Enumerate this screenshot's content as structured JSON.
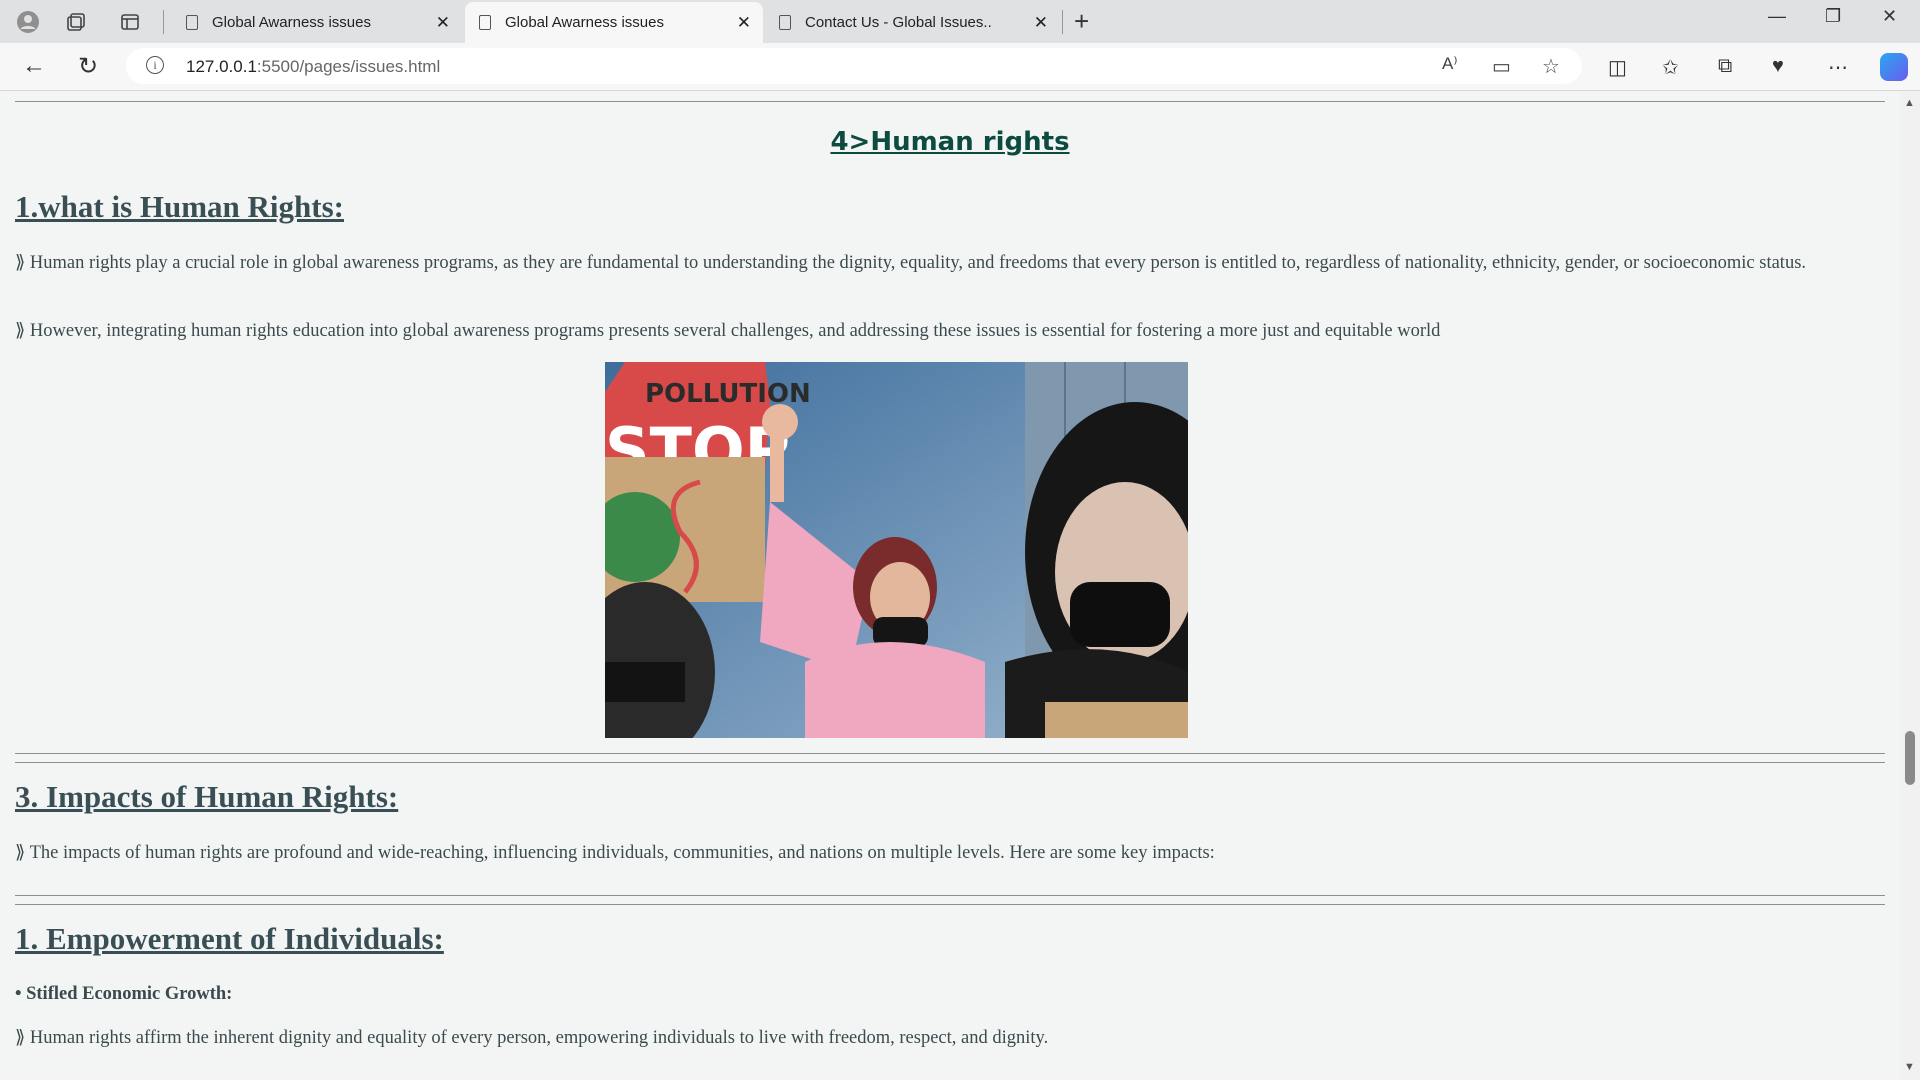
{
  "browser": {
    "tabs": [
      {
        "title": "Global Awarness issues",
        "active": false
      },
      {
        "title": "Global Awarness issues",
        "active": true
      },
      {
        "title": "Contact Us - Global Issues..",
        "active": false
      }
    ],
    "url_host": "127.0.0.1",
    "url_path": ":5500/pages/issues.html"
  },
  "page": {
    "section_title": "4>Human rights",
    "h_what": "1.what is Human Rights:",
    "p_what_1": "⟫ Human rights play a crucial role in global awareness programs, as they are fundamental to understanding the dignity, equality, and freedoms that every person is entitled to, regardless of nationality, ethnicity, gender, or socioeconomic status.",
    "p_what_2": "⟫ However, integrating human rights education into global awareness programs presents several challenges, and addressing these issues is essential for fostering a more just and equitable world",
    "photo_sign_text": "POLLUTION STOP",
    "h_impacts": "3. Impacts of Human Rights:",
    "p_impacts": "⟫ The impacts of human rights are profound and wide-reaching, influencing individuals, communities, and nations on multiple levels. Here are some key impacts:",
    "h_empower": "1. Empowerment of Individuals:",
    "bullet_item": "• Stifled Economic Growth:",
    "p_empower": "⟫ Human rights affirm the inherent dignity and equality of every person, empowering individuals to live with freedom, respect, and dignity."
  }
}
